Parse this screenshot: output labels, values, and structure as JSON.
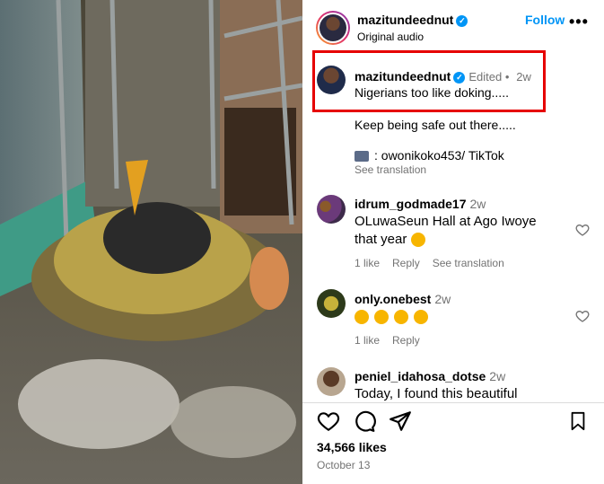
{
  "header": {
    "username": "mazitundeednut",
    "subtitle": "Original audio",
    "follow_label": "Follow",
    "more_label": "•••"
  },
  "caption": {
    "username": "mazitundeednut",
    "edited_label": "Edited •",
    "time": "2w",
    "text": "Nigerians too like doking.....",
    "line2": "Keep being safe out there.....",
    "line3": ": owonikoko453/ TikTok",
    "see_translation": "See translation"
  },
  "comments": [
    {
      "username": "idrum_godmade17",
      "time": "2w",
      "text": "OLuwaSeun Hall at Ago Iwoye that year",
      "likes": "1 like",
      "reply": "Reply",
      "see_translation": "See translation"
    },
    {
      "username": "only.onebest",
      "time": "2w",
      "likes": "1 like",
      "reply": "Reply"
    },
    {
      "username": "peniel_idahosa_dotse",
      "time": "2w",
      "text": "Today, I found this beautiful"
    }
  ],
  "footer": {
    "likes": "34,566 likes",
    "date": "October 13"
  },
  "colors": {
    "accent": "#0095f6",
    "highlight_box": "#e60000",
    "muted": "#737373"
  }
}
